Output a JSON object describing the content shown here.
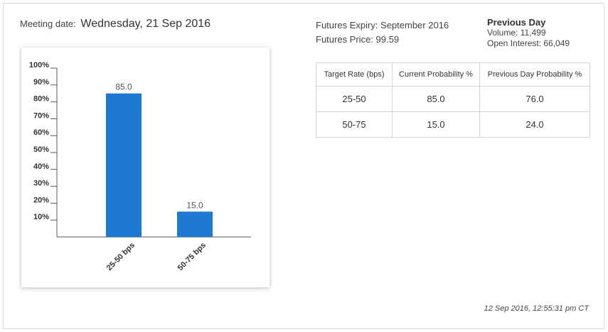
{
  "meeting": {
    "label": "Meeting date:",
    "date": "Wednesday, 21 Sep 2016"
  },
  "futures": {
    "expiry": "Futures Expiry: September 2016",
    "price": "Futures Price: 99.59"
  },
  "previous_day": {
    "heading": "Previous Day",
    "volume": "Volume: 11,499",
    "open_interest": "Open Interest: 66,049"
  },
  "table": {
    "headers": [
      "Target Rate (bps)",
      "Current Probability %",
      "Previous Day Probability %"
    ],
    "rows": [
      [
        "25-50",
        "85.0",
        "76.0"
      ],
      [
        "50-75",
        "15.0",
        "24.0"
      ]
    ]
  },
  "timestamp": "12 Sep 2016, 12:55:31 pm CT",
  "colors": {
    "bar": "#1f77d4",
    "axis": "#555555",
    "border": "#d9d9d9"
  },
  "chart_data": {
    "type": "bar",
    "categories": [
      "25-50 bps",
      "50-75 bps"
    ],
    "values": [
      85.0,
      15.0
    ],
    "value_labels": [
      "85.0",
      "15.0"
    ],
    "ytick_labels": [
      "10%",
      "20%",
      "30%",
      "40%",
      "50%",
      "60%",
      "70%",
      "80%",
      "90%",
      "100%"
    ],
    "ytick_values": [
      10,
      20,
      30,
      40,
      50,
      60,
      70,
      80,
      90,
      100
    ],
    "ylim": [
      0,
      100
    ],
    "title": "",
    "xlabel": "",
    "ylabel": "",
    "grid": false,
    "legend": "none"
  }
}
